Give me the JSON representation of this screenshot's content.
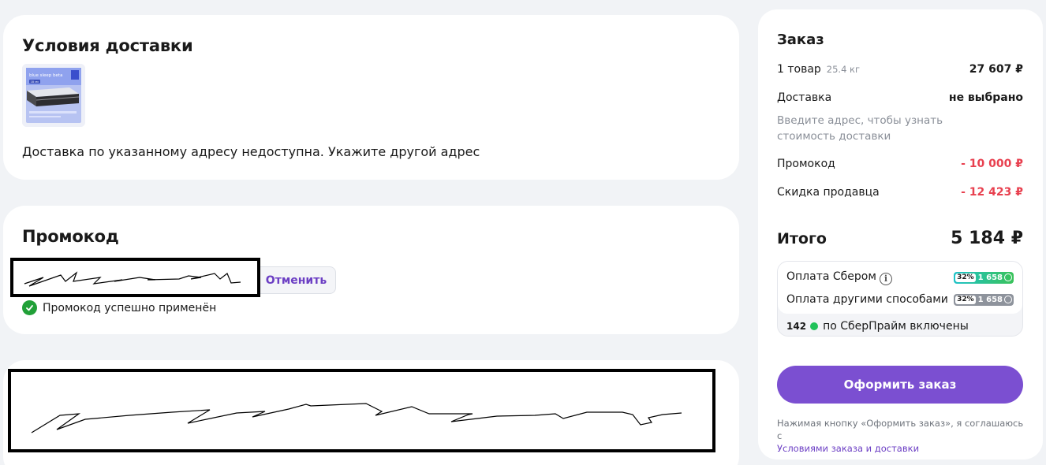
{
  "delivery": {
    "title": "Условия доставки",
    "product_image": {
      "brand_text": "blue sleep beta",
      "size_tag": "18 см"
    },
    "message": "Доставка по указанному адресу недоступна. Укажите другой адрес"
  },
  "promo": {
    "title": "Промокод",
    "cancel_label": "Отменить",
    "success_text": "Промокод успешно применён"
  },
  "order": {
    "title": "Заказ",
    "items_label": "1 товар",
    "items_weight": "25.4 кг",
    "items_price": "27 607 ₽",
    "delivery_label": "Доставка",
    "delivery_value": "не выбрано",
    "delivery_hint": "Введите адрес, чтобы узнать стоимость доставки",
    "promo_label": "Промокод",
    "promo_value": "- 10 000 ₽",
    "seller_discount_label": "Скидка продавца",
    "seller_discount_value": "- 12 423 ₽",
    "total_label": "Итого",
    "total_value": "5 184 ₽",
    "payment": {
      "sber_label": "Оплата Сбером",
      "sber_bonus_pct": "32%",
      "sber_bonus_value": "1 658",
      "other_label": "Оплата другими способами",
      "other_bonus_pct": "32%",
      "other_bonus_value": "1 658",
      "prime_points": "142",
      "prime_text": "по СберПрайм включены"
    },
    "checkout_label": "Оформить заказ",
    "legal_text": "Нажимая кнопку «Оформить заказ», я соглашаюсь с",
    "legal_link": "Условиями заказа и доставки"
  },
  "colors": {
    "accent": "#7b4fd1",
    "discount_red": "#e8404f",
    "success_green": "#21a038",
    "page_bg": "#f1f3f6"
  }
}
